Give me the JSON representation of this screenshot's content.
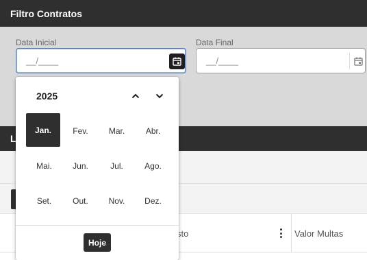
{
  "filter": {
    "title": "Filtro Contratos",
    "start_date": {
      "label": "Data Inicial",
      "value": "__/____"
    },
    "end_date": {
      "label": "Data Final",
      "value": "__/____"
    }
  },
  "list": {
    "title": "Li"
  },
  "table": {
    "columns": [
      {
        "title": "sto"
      },
      {
        "title": "Valor Multas"
      }
    ]
  },
  "picker": {
    "year": "2025",
    "months": [
      "Jan.",
      "Fev.",
      "Mar.",
      "Abr.",
      "Mai.",
      "Jun.",
      "Jul.",
      "Ago.",
      "Set.",
      "Out.",
      "Nov.",
      "Dez."
    ],
    "selected_month": "Jan.",
    "today_label": "Hoje",
    "icons": {
      "prev": "chevron-up-icon",
      "next": "chevron-down-icon"
    }
  },
  "colors": {
    "header_bg": "#2f2f2f",
    "filter_bg": "#d9d9d9",
    "focus_border": "#4a7fc1"
  }
}
